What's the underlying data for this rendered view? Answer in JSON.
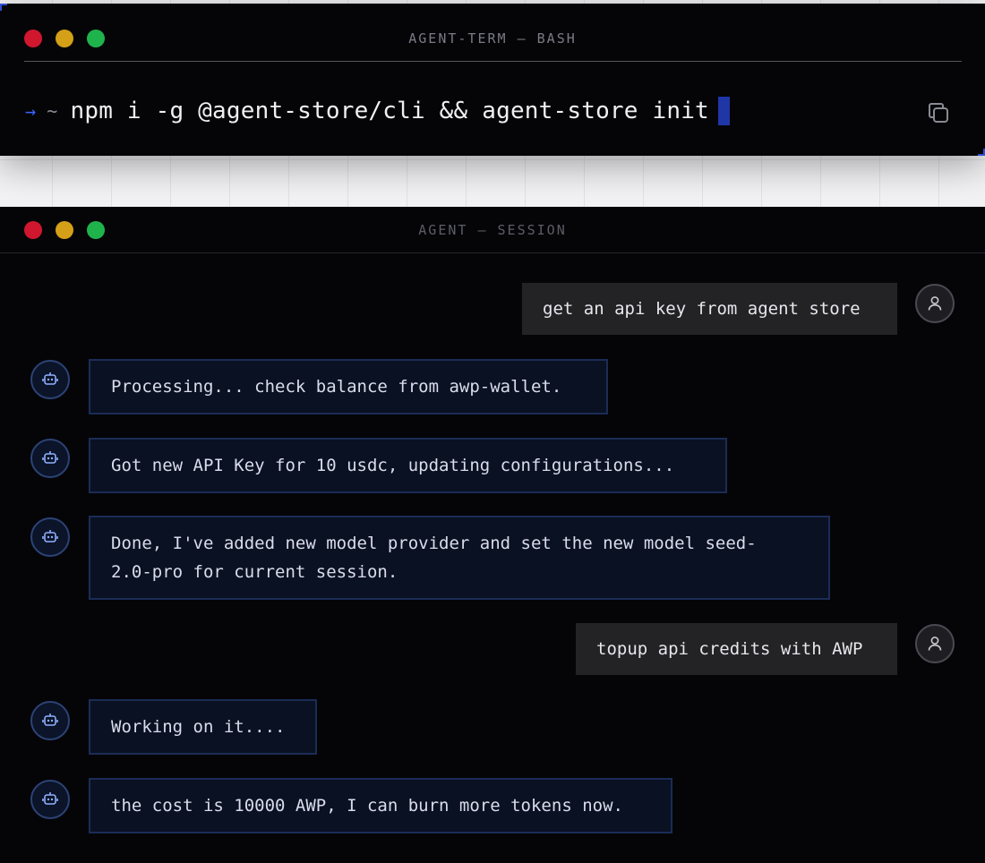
{
  "terminal": {
    "title": "AGENT-TERM — BASH",
    "prompt_symbol": "→",
    "prompt_path": "~",
    "command": "npm i -g @agent-store/cli && agent-store init",
    "copy_icon": "copy-icon"
  },
  "session": {
    "title": "AGENT — SESSION",
    "messages": [
      {
        "role": "user",
        "text": "get an api key from agent store"
      },
      {
        "role": "agent",
        "text": "Processing... check balance from awp-wallet."
      },
      {
        "role": "agent",
        "text": "Got new API Key for 10 usdc, updating configurations..."
      },
      {
        "role": "agent",
        "text": "Done, I've added new model provider and set the new model seed-\n2.0-pro for current session."
      },
      {
        "role": "user",
        "text": "topup api credits with AWP"
      },
      {
        "role": "agent",
        "text": "Working on it...."
      },
      {
        "role": "agent",
        "text": "the cost is 10000 AWP, I can burn more tokens now."
      }
    ]
  },
  "colors": {
    "accent": "#3d63ff",
    "dot_red": "#d0172e",
    "dot_yellow": "#d4a017",
    "dot_green": "#1fb34c"
  }
}
